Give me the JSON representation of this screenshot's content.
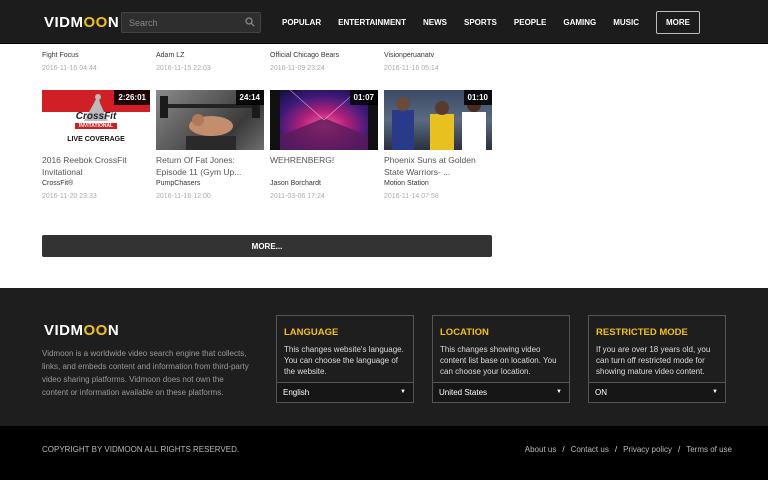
{
  "header": {
    "logo_left": "VIDM",
    "logo_o": "OO",
    "logo_right": "N",
    "search_placeholder": "Search",
    "nav": [
      "POPULAR",
      "ENTERTAINMENT",
      "NEWS",
      "SPORTS",
      "PEOPLE",
      "GAMING",
      "MUSIC"
    ],
    "more": "MORE"
  },
  "partial_row": [
    {
      "channel": "Fight Focus",
      "date": "2016-11-16 04:44"
    },
    {
      "channel": "Adam LZ",
      "date": "2016-11-15 22:03"
    },
    {
      "channel": "Official Chicago Bears",
      "date": "2016-11-09 23:24"
    },
    {
      "channel": "Visionperuanatv",
      "date": "2016-11-16 05:14"
    }
  ],
  "videos": [
    {
      "duration": "2:26:01",
      "title": "2016 Reebok CrossFit Invitational",
      "channel": "CrossFit®",
      "date": "2016-11-20 23:33",
      "thumb_text_1": "CrossFit",
      "thumb_text_2": "INVITATIONAL",
      "thumb_text_3": "LIVE COVERAGE"
    },
    {
      "duration": "24:14",
      "title": "Return Of Fat Jones: Episode 11 (Gym Up...",
      "channel": "PumpChasers",
      "date": "2016-11-16 12:00"
    },
    {
      "duration": "01:07",
      "title": "WEHRENBERG!",
      "channel": "Jason Borchardt",
      "date": "2011-03-06 17:24"
    },
    {
      "duration": "01:10",
      "title": "Phoenix Suns at Golden State Warriors- ...",
      "channel": "Motion Station",
      "date": "2016-11-14 07:58"
    }
  ],
  "more_button": "MORE...",
  "footer": {
    "description": "Vidmoon is a worldwide video search engine that collects, links, and embeds content and information from third-party video sharing platforms. Vidmoon does not own the content or information available on these platforms.",
    "boxes": [
      {
        "heading": "LANGUAGE",
        "text": "This changes website's language. You can choose the language of the website.",
        "value": "English"
      },
      {
        "heading": "LOCATION",
        "text": "This changes showing video content list base on location. You can choose your location.",
        "value": "United States"
      },
      {
        "heading": "RESTRICTED MODE",
        "text": "If you are over 18 years old, you can turn off restricted mode for showing mature video content.",
        "value": "ON"
      }
    ],
    "copyright": "COPYRIGHT BY VIDMOON ALL RIGHTS RESERVED.",
    "links": [
      "About us",
      "Contact us",
      "Privacy policy",
      "Terms of use"
    ],
    "separator": "/"
  },
  "colors": {
    "accent": "#f2c012",
    "header_bg": "#1c1c1c",
    "footer_bg": "#1e1e1e"
  }
}
